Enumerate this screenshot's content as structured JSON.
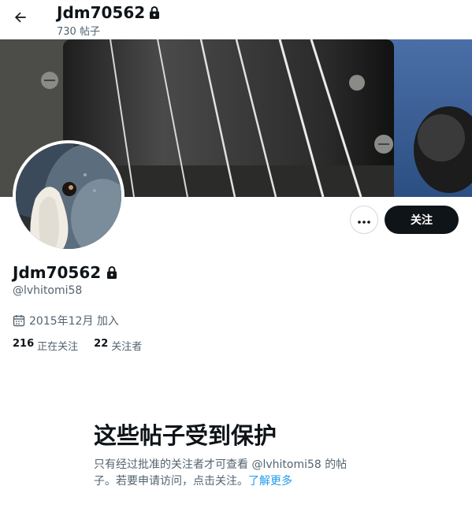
{
  "header": {
    "display_name": "Jdm70562",
    "posts_count": "730 帖子"
  },
  "profile": {
    "display_name": "Jdm70562",
    "handle": "@lvhitomi58",
    "joined": "2015年12月 加入",
    "following_count": "216",
    "following_label": "正在关注",
    "followers_count": "22",
    "followers_label": "关注者"
  },
  "actions": {
    "follow_label": "关注"
  },
  "protected": {
    "title": "这些帖子受到保护",
    "text": "只有经过批准的关注者才可查看 @lvhitomi58 的帖子。若要申请访问，点击关注。",
    "learn_more": "了解更多"
  },
  "colors": {
    "accent": "#1d9bf0",
    "text_primary": "#0f1419",
    "text_secondary": "#536471",
    "button_dark": "#0f1419"
  },
  "icons": [
    "back-arrow-icon",
    "lock-icon",
    "more-icon",
    "calendar-icon"
  ]
}
